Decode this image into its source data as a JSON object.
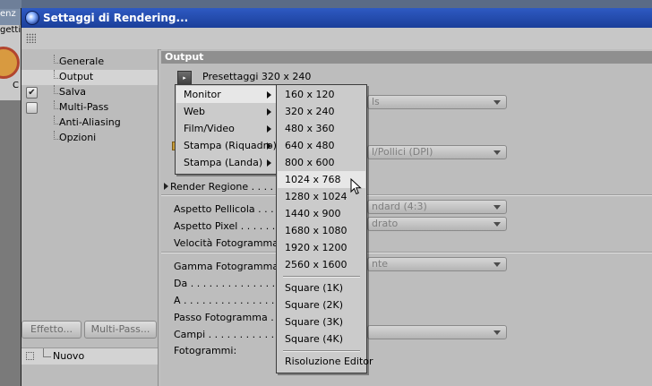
{
  "background_app": {
    "title_fragment": "enz",
    "menu_fragment": "getti",
    "row_fragment": "C"
  },
  "dialog": {
    "title": "Settaggi di Rendering..."
  },
  "sidebar": {
    "items": [
      {
        "label": "Generale",
        "checked": null
      },
      {
        "label": "Output",
        "checked": null
      },
      {
        "label": "Salva",
        "checked": true
      },
      {
        "label": "Multi-Pass",
        "checked": false
      },
      {
        "label": "Anti-Aliasing",
        "checked": null
      },
      {
        "label": "Opzioni",
        "checked": null
      }
    ],
    "check_mark": "✔",
    "effect_button": "Effetto...",
    "multipass_button": "Multi-Pass...",
    "new_item": "Nuovo"
  },
  "output": {
    "section_title": "Output",
    "preset_label": "Presettaggi 320 x 240",
    "combo_top_value": "ls",
    "combo_dpi_value": "l/Pollici (DPI)",
    "render_region_label": "Render Regione . . . . . .",
    "film_aspect_label": "Aspetto Pellicola . . . . . . . .",
    "film_aspect_value": "ndard (4:3)",
    "pixel_aspect_label": "Aspetto Pixel . . . . . . . . .",
    "pixel_aspect_value": "drato",
    "frame_rate_label": "Velocità Fotogramma . . . . .",
    "frame_range_label": "Gamma Fotogramma . . . . .",
    "frame_range_value": "nte",
    "from_label": "Da . . . . . . . . . . . . . . . .",
    "to_label": "A . . . . . . . . . . . . . . . . .",
    "frame_step_label": "Passo Fotogramma . . . . . .",
    "fields_label": "Campi . . . . . . . . . . . . . .",
    "frames_label": "Fotogrammi:"
  },
  "preset_menu": {
    "items": [
      "Monitor",
      "Web",
      "Film/Video",
      "Stampa (Riquadro)",
      "Stampa (Landa)"
    ],
    "highlighted": "Monitor"
  },
  "resolution_menu": {
    "group1": [
      "160 x 120",
      "320 x 240",
      "480 x 360",
      "640 x 480",
      "800 x 600",
      "1024 x 768",
      "1280 x 1024",
      "1440 x 900",
      "1680 x 1080",
      "1920 x 1200",
      "2560 x 1600"
    ],
    "group2": [
      "Square (1K)",
      "Square (2K)",
      "Square (3K)",
      "Square (4K)"
    ],
    "group3": [
      "Risoluzione Editor"
    ],
    "highlighted": "1024 x 768"
  }
}
